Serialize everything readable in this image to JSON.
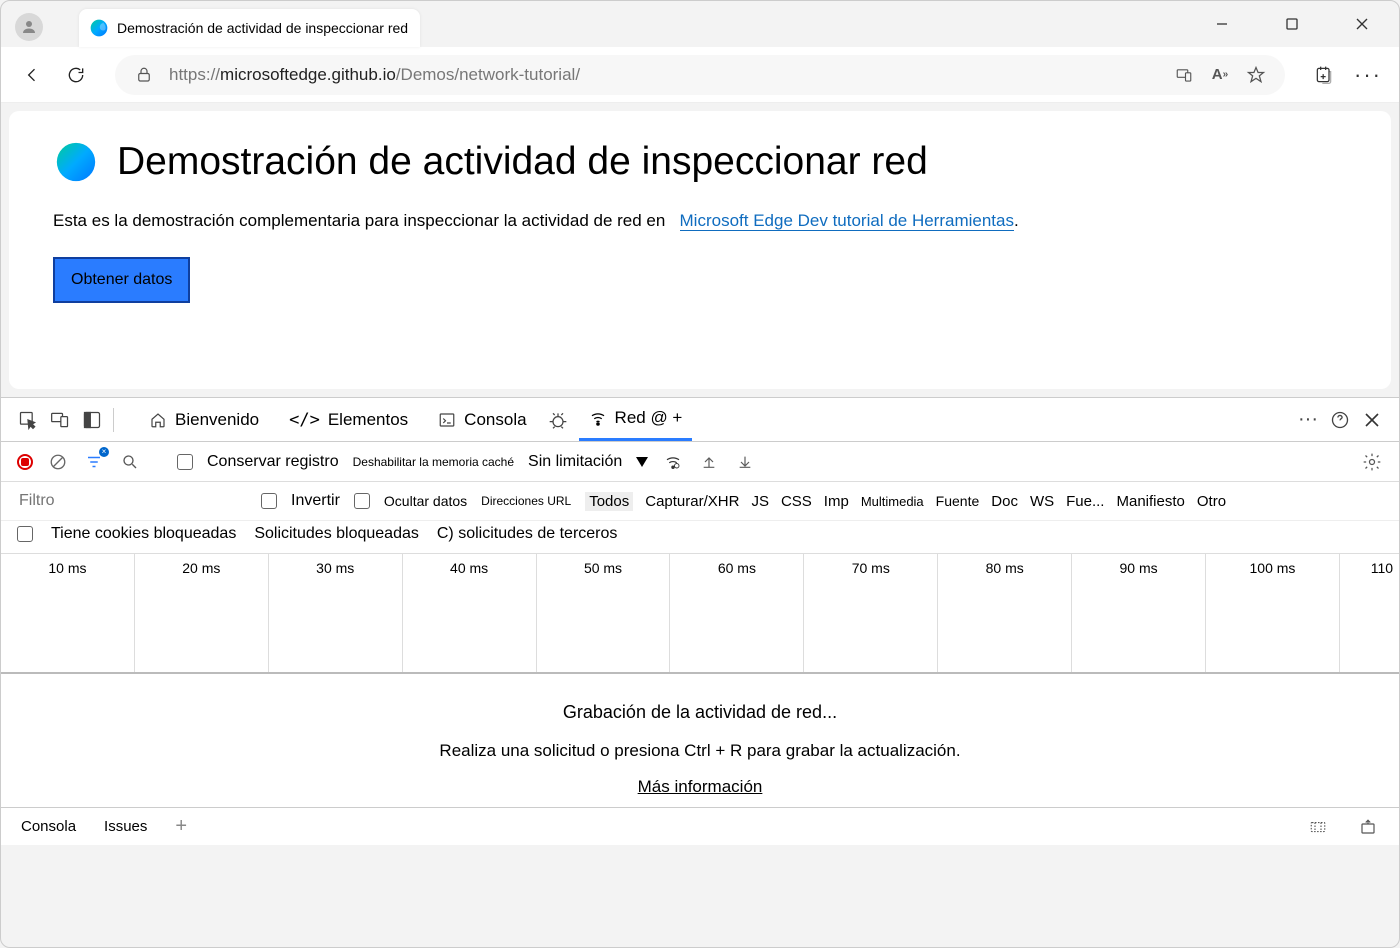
{
  "browser": {
    "tab_title": "Demostración de actividad de inspeccionar red",
    "url_prefix": "https://",
    "url_host": "microsoftedge.github.io",
    "url_path": "/Demos/network-tutorial/"
  },
  "page": {
    "title": "Demostración de actividad de inspeccionar red",
    "desc_before": "Esta es la demostración complementaria para inspeccionar la actividad de red en ",
    "desc_link": "Microsoft Edge Dev tutorial de Herramientas",
    "desc_after": ".",
    "button": "Obtener datos"
  },
  "devtools": {
    "tabs": {
      "welcome": "Bienvenido",
      "elements": "Elementos",
      "console": "Consola",
      "network": "Red @ +"
    },
    "netbar": {
      "preserve": "Conservar registro",
      "disable_cache": "Deshabilitar la memoria caché",
      "throttle": "Sin limitación"
    },
    "filter": {
      "placeholder": "Filtro",
      "invert": "Invertir",
      "hide_data": "Ocultar datos",
      "addr_url": "Direcciones URL"
    },
    "types": {
      "all": "Todos",
      "fetch": "Capturar/XHR",
      "js": "JS",
      "css": "CSS",
      "img": "Imp",
      "media": "Multimedia",
      "font": "Fuente",
      "doc": "Doc",
      "ws": "WS",
      "fue": "Fue...",
      "manifest": "Manifiesto",
      "other": "Otro"
    },
    "filter2": {
      "blocked_cookies": "Tiene cookies bloqueadas",
      "blocked_req": "Solicitudes bloqueadas",
      "third_party": "C) solicitudes de terceros"
    },
    "timeline": [
      "10 ms",
      "20 ms",
      "30 ms",
      "40 ms",
      "50 ms",
      "60 ms",
      "70 ms",
      "80 ms",
      "90 ms",
      "100 ms",
      "110"
    ],
    "recording": {
      "title": "Grabación de la actividad de red...",
      "hint": "Realiza una solicitud o presiona Ctrl + R para grabar la actualización.",
      "more": "Más información"
    },
    "bottom": {
      "console": "Consola",
      "issues": "Issues"
    }
  }
}
